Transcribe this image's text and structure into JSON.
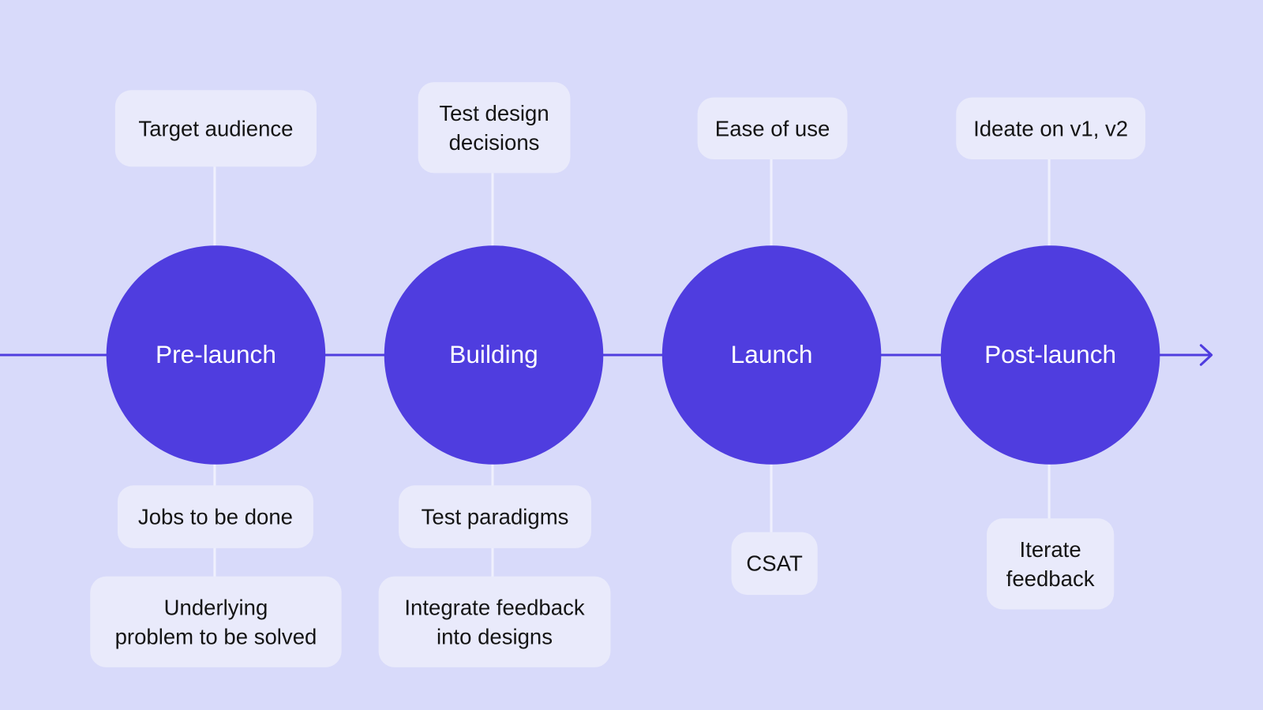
{
  "colors": {
    "background": "#d8dafa",
    "stage": "#4f3ddf",
    "box": "#e9eafb",
    "connector": "#eff0fd"
  },
  "stages": [
    {
      "label": "Pre-launch",
      "above": [
        "Target audience"
      ],
      "below": [
        "Jobs to be done",
        "Underlying\nproblem to be solved"
      ]
    },
    {
      "label": "Building",
      "above": [
        "Test design\ndecisions"
      ],
      "below": [
        "Test paradigms",
        "Integrate feedback\ninto designs"
      ]
    },
    {
      "label": "Launch",
      "above": [
        "Ease of use"
      ],
      "below": [
        "CSAT"
      ]
    },
    {
      "label": "Post-launch",
      "above": [
        "Ideate on v1, v2"
      ],
      "below": [
        "Iterate\nfeedback"
      ]
    }
  ]
}
